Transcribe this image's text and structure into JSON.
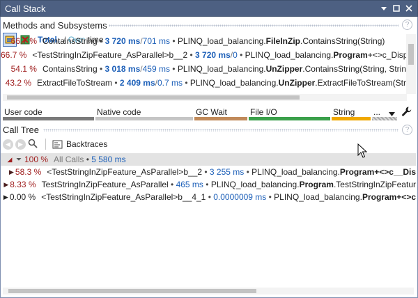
{
  "window": {
    "title": "Call Stack"
  },
  "methods": {
    "header": "Methods and Subsystems",
    "toggle": {
      "total": "Total",
      "arrow": "↓",
      "slash": " / ",
      "own": "Own",
      "suffix": " time"
    },
    "rows": [
      {
        "pct": "66.7 %",
        "name": "ContainsString",
        "time_total": "3 720 ms",
        "slash": " / ",
        "time_own": "701 ms",
        "ns": "PLINQ_load_balancing.",
        "cls": "FileInZip",
        "member": ".ContainsString(String)"
      },
      {
        "pct": "66.7 %",
        "name": "<TestStringInZipFeature_AsParallel>b__2",
        "time_total": "3 720 ms",
        "slash": " / ",
        "time_own": "0",
        "ns": "PLINQ_load_balancing.",
        "cls": "Program",
        "member": "+<>c_Displ"
      },
      {
        "pct": "54.1 %",
        "name": "ContainsString",
        "time_total": "3 018 ms",
        "slash": " / ",
        "time_own": "459 ms",
        "ns": "PLINQ_load_balancing.",
        "cls": "UnZipper",
        "member": ".ContainsString(String, Strin"
      },
      {
        "pct": "43.2 %",
        "name": "ExtractFileToStream",
        "time_total": "2 409 ms",
        "slash": " / ",
        "time_own": "0.7 ms",
        "ns": "PLINQ_load_balancing.",
        "cls": "UnZipper",
        "member": ".ExtractFileToStream(Str"
      }
    ]
  },
  "subsystems": [
    {
      "label": "User code",
      "color": "#7a7a7a"
    },
    {
      "label": "Native code",
      "color": "#c5c5c5"
    },
    {
      "label": "GC Wait",
      "color": "#c08a5a"
    },
    {
      "label": "File I/O",
      "color": "#3aa04a"
    },
    {
      "label": "String",
      "color": "#f0a800"
    },
    {
      "label": "...",
      "color": "#a8a8a8"
    }
  ],
  "calltree": {
    "header": "Call Tree",
    "backtraces_label": "Backtraces",
    "root": {
      "pct": "100 %",
      "label": "All Calls",
      "time": "5 580 ms"
    },
    "rows": [
      {
        "tri": "▶",
        "pct": "58.3 %",
        "name": "<TestStringInZipFeature_AsParallel>b__2",
        "time": "3 255 ms",
        "ns": "PLINQ_load_balancing.",
        "cls": "Program",
        "member": "+<>c__Dis"
      },
      {
        "tri": "▶",
        "pct": "8.33 %",
        "name": "TestStringInZipFeature_AsParallel",
        "time": "465 ms",
        "ns": "PLINQ_load_balancing.",
        "cls": "Program",
        "member": ".TestStringInZipFeatur"
      },
      {
        "tri": "▶",
        "pct": "0.00 %",
        "name": "<TestStringInZipFeature_AsParallel>b__4_1",
        "time": "0.0000009 ms",
        "ns": "PLINQ_load_balancing.",
        "cls": "Program",
        "member": "+<>c"
      }
    ]
  }
}
